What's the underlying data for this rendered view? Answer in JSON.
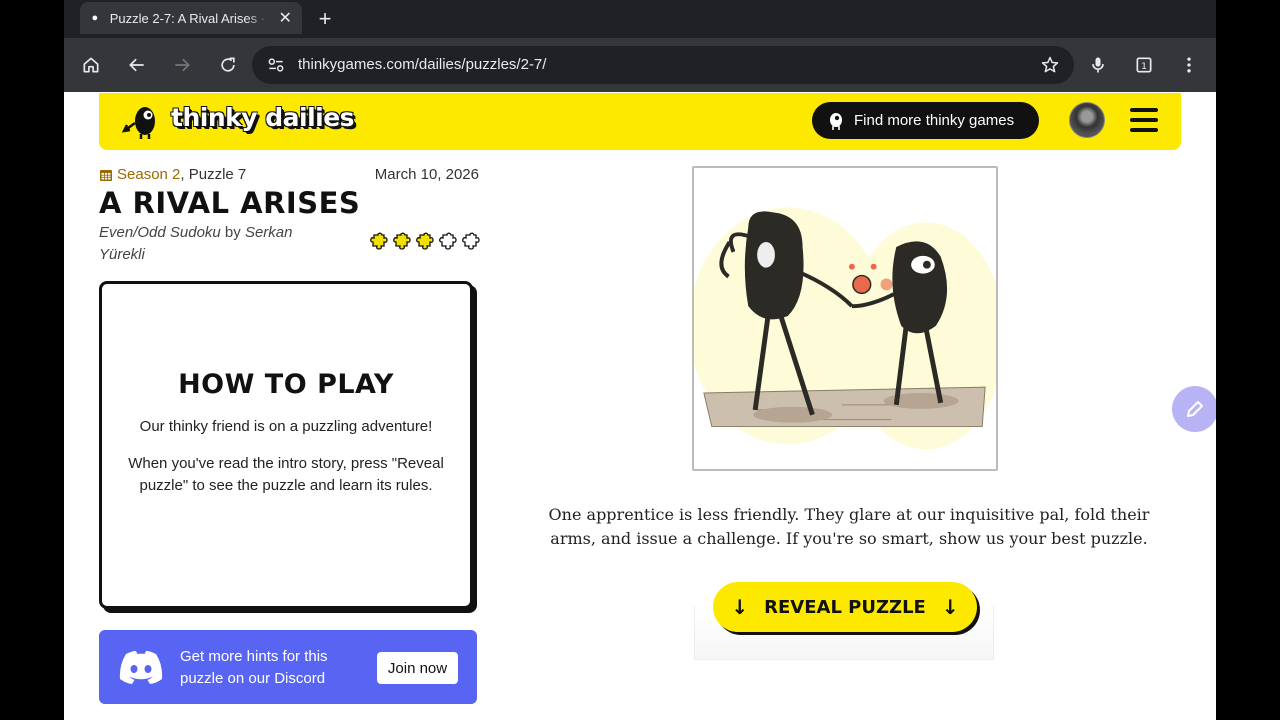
{
  "browser": {
    "tab_title": "Puzzle 2-7: A Rival Arises · Thinky Dailies",
    "url": "thinkygames.com/dailies/puzzles/2-7/",
    "tab_count": "1"
  },
  "header": {
    "logo_text": "thinky dailies",
    "find_games_label": "Find more thinky games"
  },
  "puzzle": {
    "season_link": "Season 2",
    "puzzle_label": ", Puzzle 7",
    "date": "March 10, 2026",
    "title": "A RIVAL ARISES",
    "genre": "Even/Odd Sudoku",
    "by": " by ",
    "author": "Serkan Yürekli",
    "difficulty": 3,
    "difficulty_max": 5
  },
  "how_to_play": {
    "heading": "HOW TO PLAY",
    "p1": "Our thinky friend is on a puzzling adventure!",
    "p2": "When you've read the intro story, press \"Reveal puzzle\" to see the puzzle and learn its rules."
  },
  "discord": {
    "text": "Get more hints for this puzzle on our Discord",
    "button": "Join now"
  },
  "story": {
    "text": "One apprentice is less friendly. They glare at our inquisitive pal, fold their arms, and issue a challenge. If you're so smart, show us your best puzzle.",
    "reveal_label": "REVEAL PUZZLE"
  },
  "colors": {
    "brand_yellow": "#fde900",
    "discord": "#5865f2",
    "star_filled": "#f2e100",
    "star_empty": "#ffffff"
  }
}
